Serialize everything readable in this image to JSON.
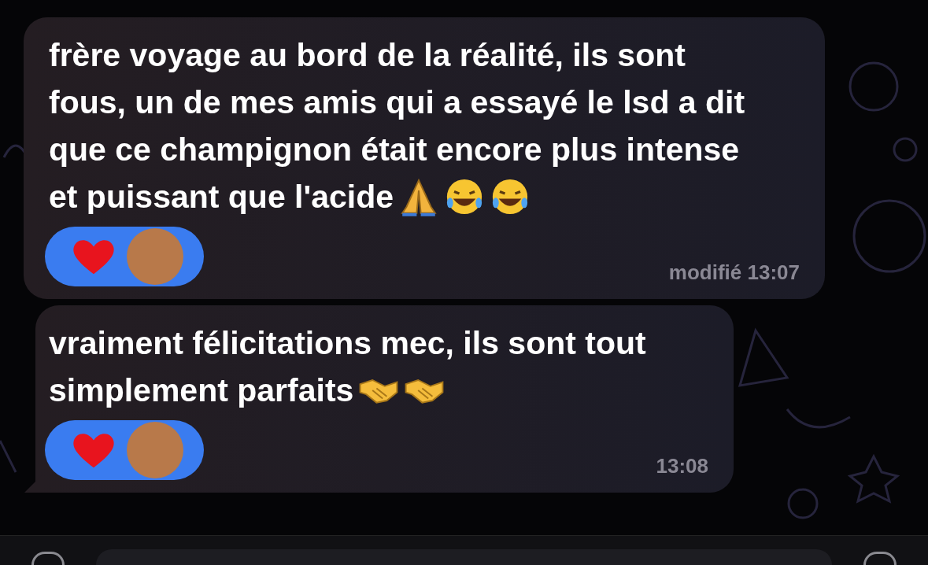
{
  "messages": [
    {
      "lines": [
        "frère voyage au bord de la réalité, ils sont",
        "fous, un de mes amis qui a essayé le lsd a dit",
        "que ce champignon était encore plus intense",
        "et puissant que l'acide"
      ],
      "emojis": [
        {
          "kind": "pray"
        },
        {
          "kind": "laugh"
        },
        {
          "kind": "laugh"
        }
      ],
      "reactions": [
        {
          "kind": "heart"
        }
      ],
      "time": "modifié 13:07",
      "tail": false
    },
    {
      "lines": [
        "vraiment félicitations mec, ils sont tout",
        "simplement parfaits"
      ],
      "emojis": [
        {
          "kind": "handshake"
        },
        {
          "kind": "handshake"
        }
      ],
      "reactions": [
        {
          "kind": "heart"
        }
      ],
      "time": "13:08",
      "tail": true
    }
  ]
}
